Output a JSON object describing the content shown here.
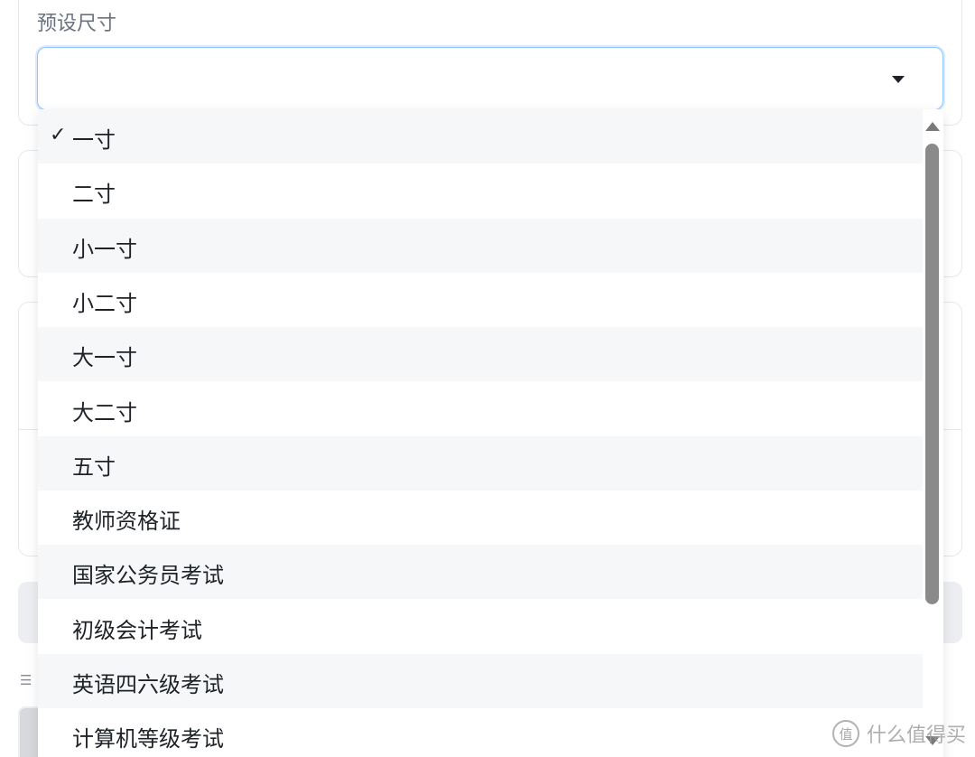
{
  "field": {
    "label": "预设尺寸",
    "selected_value": ""
  },
  "dropdown": {
    "selected_index": 0,
    "check_mark": "✓",
    "options": [
      "一寸",
      "二寸",
      "小一寸",
      "小二寸",
      "大一寸",
      "大二寸",
      "五寸",
      "教师资格证",
      "国家公务员考试",
      "初级会计考试",
      "英语四六级考试",
      "计算机等级考试"
    ]
  },
  "list_icon": "☰",
  "watermark": {
    "logo_text": "值",
    "text": "什么值得买"
  },
  "colors": {
    "focus_border": "#93c5fd",
    "option_hover_bg": "#f6f7f9",
    "scrollbar": "#8a8a8a"
  },
  "icons": {
    "caret": "chevron-down-icon",
    "check": "check-icon",
    "scroll_up": "scroll-up-arrow-icon",
    "scroll_down": "scroll-down-arrow-icon"
  }
}
